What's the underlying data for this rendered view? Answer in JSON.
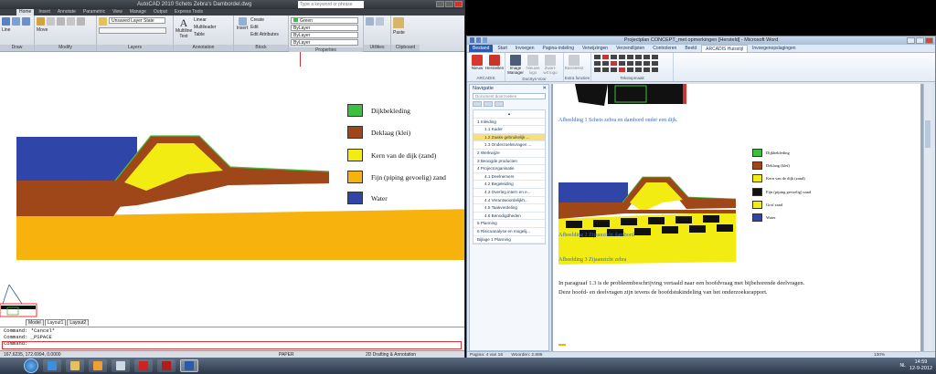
{
  "acad": {
    "title": "AutoCAD 2010    Schets Zebra's Dambordel.dwg",
    "search_placeholder": "Type a keyword or phrase",
    "tabs": [
      "Home",
      "Insert",
      "Annotate",
      "Parametric",
      "View",
      "Manage",
      "Output",
      "Express Tools"
    ],
    "ribbon": {
      "draw_label": "Draw",
      "modify_label": "Modify",
      "layers_label": "Layers",
      "annotation_label": "Annotation",
      "block_label": "Block",
      "properties_label": "Properties",
      "utilities_label": "Utilities",
      "clipboard_label": "Clipboard",
      "line": "Line",
      "move": "Move",
      "layer_state": "Unsaved Layer State",
      "multiline_text": "Multiline Text",
      "linear": "Linear",
      "multileader": "Multileader",
      "table": "Table",
      "insert": "Insert",
      "create": "Create",
      "edit": "Edit",
      "edit_attributes": "Edit Attributes",
      "color": "Green",
      "bylayer1": "ByLayer",
      "bylayer2": "ByLayer",
      "bylayer3": "ByLayer",
      "paste": "Paste"
    },
    "legend": [
      {
        "label": "Dijkbekleding",
        "color": "#3fbf3f"
      },
      {
        "label": "Deklaag (klei)",
        "color": "#a0471a"
      },
      {
        "label": "Kern van de dijk (zand)",
        "color": "#f3ec12"
      },
      {
        "label": "Fijn (piping gevoelig) zand",
        "color": "#f7b20d"
      },
      {
        "label": "Water",
        "color": "#2f46a8"
      }
    ],
    "layout_tabs": [
      "Model",
      "Layout1",
      "Layout2"
    ],
    "command_lines": [
      "Command: *Cancel*",
      "Command: _PSPACE",
      "Command:"
    ],
    "status_coords": "167.6235, 172.6994, 0.0000",
    "status_paper": "PAPER",
    "status_workspace": "2D Drafting & Annotation"
  },
  "word": {
    "title": "Projectplan CONCEPT_met opmerkingen [Hersteld] - Microsoft Word",
    "tabs": [
      "Bestand",
      "Start",
      "Invoegen",
      "Pagina-indeling",
      "Verwijzingen",
      "Verzendlijsten",
      "Controleren",
      "Beeld",
      "ARCADIS Huisstijl",
      "Invoegenopslagingen"
    ],
    "ribbon": {
      "nieuw": "Nieuw",
      "herstellen": "Herstellen",
      "image_manager": "Image Manager",
      "nieuwe_logo": "Nieuwe logo",
      "zwart_wit_logo": "Zwart-wit logo",
      "basistekst": "Basistekst",
      "group1": "ARCADIS",
      "group2": "DocSys-Voor",
      "group3": "Extra functies",
      "group4": "Tekstopmaak"
    },
    "nav": {
      "title": "Navigatie",
      "search_placeholder": "Document doorzoeken",
      "items": [
        {
          "text": "1 Inleiding",
          "level": 1,
          "selected": false
        },
        {
          "text": "1.1 Kader",
          "level": 2,
          "selected": false
        },
        {
          "text": "1.2 Zaaks gebruikelijk ...",
          "level": 2,
          "selected": true
        },
        {
          "text": "1.3 Onderzoeksvragen ...",
          "level": 2,
          "selected": false
        },
        {
          "text": "2 Werkwijze",
          "level": 1,
          "selected": false
        },
        {
          "text": "3 Beoogde producten",
          "level": 1,
          "selected": false
        },
        {
          "text": "4 Projectorganisatie",
          "level": 1,
          "selected": false
        },
        {
          "text": "4.1 Deelnemers",
          "level": 2,
          "selected": false
        },
        {
          "text": "4.2 Begeleiding",
          "level": 2,
          "selected": false
        },
        {
          "text": "4.3 Overleg intern en e...",
          "level": 2,
          "selected": false
        },
        {
          "text": "4.4 Verantwoordelijkh...",
          "level": 2,
          "selected": false
        },
        {
          "text": "4.5 Taakverdeling",
          "level": 2,
          "selected": false
        },
        {
          "text": "4.6 Benodigdheden",
          "level": 2,
          "selected": false
        },
        {
          "text": "5 Planning",
          "level": 1,
          "selected": false
        },
        {
          "text": "6 Risicoanalyse en mogelij...",
          "level": 1,
          "selected": false
        },
        {
          "text": "Bijlage 1 Planning",
          "level": 1,
          "selected": false
        }
      ]
    },
    "caption1": "Afbeelding 1 Schets zebra en dambord onder een dijk.",
    "caption2": "Afbeelding 2 Zijaanzicht dambord",
    "caption3": "Afbeelding 3 Zijaanzicht zebra",
    "mini_legend": [
      {
        "label": "Dijkbekleding",
        "color": "#3fbf3f"
      },
      {
        "label": "Deklaag (klei)",
        "color": "#a0471a"
      },
      {
        "label": "Kern van de dijk (zand)",
        "color": "#f3ec12"
      },
      {
        "label": "Fijn (piping gevoelig) zand",
        "color": "#111111"
      },
      {
        "label": "Grof zand",
        "color": "#f3ec12"
      },
      {
        "label": "Water",
        "color": "#2f46a8"
      }
    ],
    "paragraph_line1": "In paragraaf 1.3 is de probleembeschrijving vertaald naar een hoofdvraag met bijbehorende deelvragen.",
    "paragraph_line2": "Deze hoofd- en deelvragen zijn tevens de hoofdstukindeling van het onderzoeksrapport.",
    "status_page": "Pagina: 4 van 16",
    "status_words": "Woorden: 2.885",
    "zoom": "130%"
  },
  "taskbar": {
    "lang": "NL",
    "time": "14:59",
    "date": "12-9-2012"
  }
}
